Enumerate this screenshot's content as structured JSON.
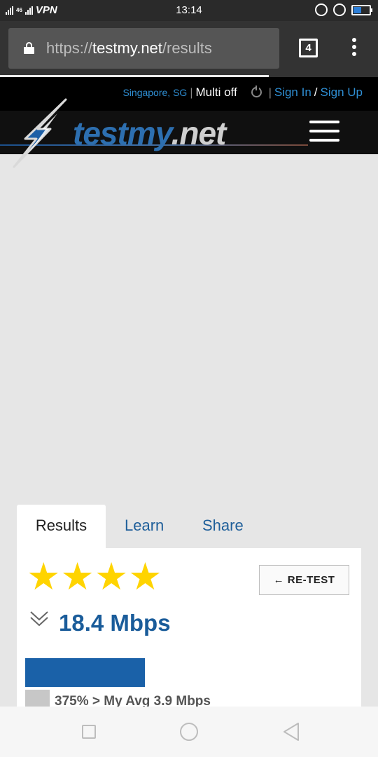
{
  "status_bar": {
    "signal": "46",
    "vpn": "VPN",
    "time": "13:14"
  },
  "browser": {
    "url_scheme": "https://",
    "url_host": "testmy.net",
    "url_path": "/results",
    "tab_count": "4"
  },
  "site_header": {
    "location": "Singapore, SG",
    "separator": "|",
    "multi": "Multi off",
    "sign_in": "Sign In",
    "slash": "/",
    "sign_up": "Sign Up"
  },
  "logo": {
    "brand": "testmy",
    "suffix": ".net"
  },
  "tabs": [
    {
      "label": "Results"
    },
    {
      "label": "Learn"
    },
    {
      "label": "Share"
    }
  ],
  "result": {
    "stars": "★★★★",
    "rating": 4,
    "retest_label": "← RE-TEST",
    "speed": "18.4 Mbps",
    "compare": "375% > My Avg 3.9 Mbps"
  },
  "colors": {
    "accent_blue": "#1a5c9a",
    "star_yellow": "#ffd400",
    "header_bg": "#000000"
  }
}
